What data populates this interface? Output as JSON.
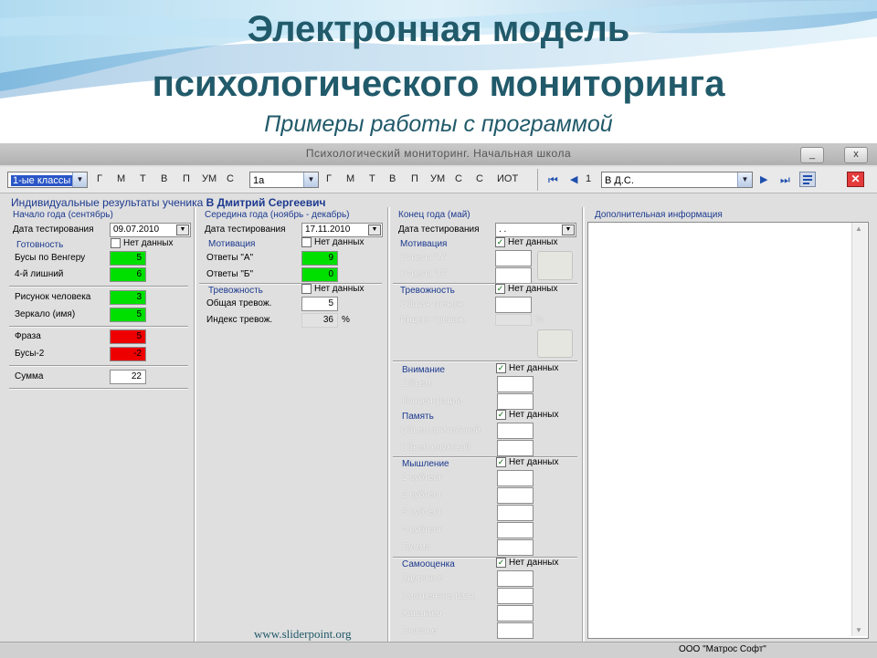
{
  "slide": {
    "title_line1": "Электронная модель",
    "title_line2": "психологического мониторинга",
    "subtitle": "Примеры работы с программой",
    "watermark": "www.sliderpoint.org",
    "accent": "#215a6a"
  },
  "window": {
    "title": "Психологический мониторинг. Начальная школа",
    "minimize_label": "_",
    "close_label": "x"
  },
  "toolbar": {
    "class_select": "1-ые классы",
    "letters1": [
      "Г",
      "М",
      "Т",
      "В",
      "П",
      "УМ",
      "С"
    ],
    "group_select": "1а",
    "letters2": [
      "Г",
      "М",
      "Т",
      "В",
      "П",
      "УМ",
      "С",
      "С",
      "ИОТ"
    ],
    "record_number": "1",
    "student_select": "В Д.С."
  },
  "header": {
    "prefix": "Индивидуальные результаты ученика",
    "student": "В Дмитрий Сергеевич"
  },
  "col1": {
    "title": "Начало года (сентябрь)",
    "date_label": "Дата тестирования",
    "date": "09.07.2010",
    "readiness": "Готовность",
    "nodata": "Нет данных",
    "rows": [
      {
        "label": "Бусы по Венгеру",
        "value": "5",
        "color": "green"
      },
      {
        "label": "4-й лишний",
        "value": "6",
        "color": "green"
      },
      {
        "label": "Рисунок человека",
        "value": "3",
        "color": "green"
      },
      {
        "label": "Зеркало (имя)",
        "value": "5",
        "color": "green"
      },
      {
        "label": "Фраза",
        "value": "5",
        "color": "red"
      },
      {
        "label": "Бусы-2",
        "value": "-2",
        "color": "red"
      }
    ],
    "sum_label": "Сумма",
    "sum": "22"
  },
  "col2": {
    "title": "Середина года (ноябрь - декабрь)",
    "date_label": "Дата тестирования",
    "date": "17.11.2010",
    "motivation": "Мотивация",
    "nodata": "Нет данных",
    "answers_a": "Ответы \"А\"",
    "answers_a_val": "9",
    "answers_b": "Ответы \"Б\"",
    "answers_b_val": "0",
    "anxiety": "Тревожность",
    "general_anx": "Общая тревож.",
    "general_anx_val": "5",
    "anx_index": "Индекс тревож.",
    "anx_index_val": "36",
    "percent": "%"
  },
  "col3": {
    "title": "Конец года (май)",
    "date_label": "Дата тестирования",
    "date": ". .",
    "nodata": "Нет данных",
    "motivation": "Мотивация",
    "answers_a": "Ответы \"А\"",
    "answers_b": "Ответы \"Б\"",
    "anxiety": "Тревожность",
    "general_anx": "Общая тревож.",
    "anx_index": "Индекс тревож.",
    "percent": "%",
    "attention": "Внимание",
    "volume": "Объем",
    "concentration": "Концентрации",
    "memory": "Память",
    "visual_mem": "Объем зрительной",
    "aud_mem": "Объем слуховой",
    "thinking": "Мышление",
    "subtests": [
      "1 субтест",
      "2 субтест",
      "3 субтест",
      "4 субтест"
    ],
    "sum": "Сумма",
    "selfesteem": "Самооценка",
    "se_rows": [
      "Здоровье",
      "Умственное разв.",
      "Характер",
      "Счастье"
    ]
  },
  "col4": {
    "title": "Дополнительная информация"
  },
  "status": {
    "company": "ООО \"Матрос Софт\""
  }
}
